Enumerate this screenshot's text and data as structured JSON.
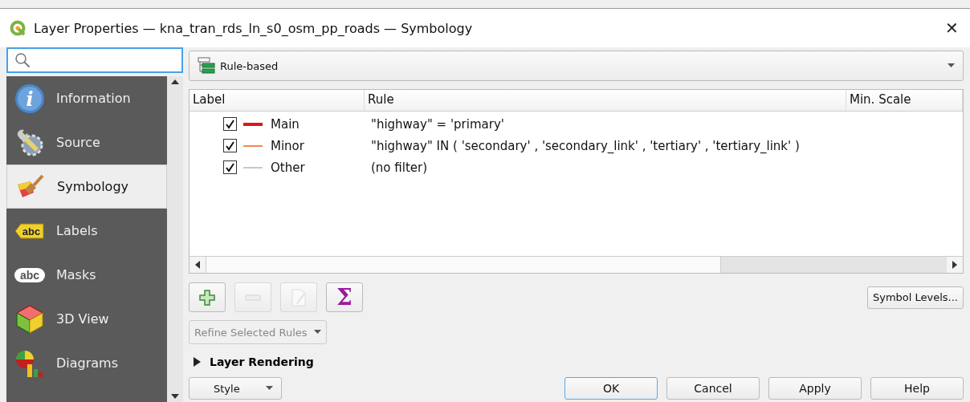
{
  "window": {
    "title": "Layer Properties — kna_tran_rds_ln_s0_osm_pp_roads — Symbology",
    "close": "✕"
  },
  "sidebar": {
    "items": [
      {
        "label": "Information",
        "kind": "info",
        "icon_text": "i",
        "selected": false
      },
      {
        "label": "Source",
        "kind": "source",
        "selected": false
      },
      {
        "label": "Symbology",
        "kind": "symbology",
        "selected": true
      },
      {
        "label": "Labels",
        "kind": "labels",
        "icon_text": "abc",
        "selected": false
      },
      {
        "label": "Masks",
        "kind": "masks",
        "icon_text": "abc",
        "selected": false
      },
      {
        "label": "3D View",
        "kind": "cube",
        "selected": false
      },
      {
        "label": "Diagrams",
        "kind": "diagrams",
        "selected": false
      }
    ]
  },
  "renderer": {
    "label": "Rule-based"
  },
  "table": {
    "columns": [
      "Label",
      "Rule",
      "Min. Scale"
    ],
    "rows": [
      {
        "checked": true,
        "label": "Main",
        "color": "#d7191c",
        "rule": "\"highway\"  =  'primary'"
      },
      {
        "checked": true,
        "label": "Minor",
        "color": "#f08a50",
        "rule": "\"highway\" IN ( 'secondary' , 'secondary_link' , 'tertiary' , 'tertiary_link' )"
      },
      {
        "checked": true,
        "label": "Other",
        "color": "#c8c8c8",
        "rule": "(no filter)"
      }
    ]
  },
  "tools": [
    {
      "kind": "add",
      "disabled": false
    },
    {
      "kind": "remove",
      "disabled": true
    },
    {
      "kind": "edit",
      "disabled": true
    },
    {
      "kind": "sigma",
      "label": "Σ",
      "disabled": false
    }
  ],
  "symbol_levels": "Symbol Levels...",
  "refine": {
    "label": "Refine Selected Rules",
    "disabled": true
  },
  "layer_rendering": {
    "label": "Layer Rendering",
    "expanded": false
  },
  "footer": {
    "style": "Style",
    "buttons": [
      {
        "label": "OK",
        "default": true
      },
      {
        "label": "Cancel",
        "default": false
      },
      {
        "label": "Apply",
        "default": false
      },
      {
        "label": "Help",
        "default": false
      }
    ]
  }
}
